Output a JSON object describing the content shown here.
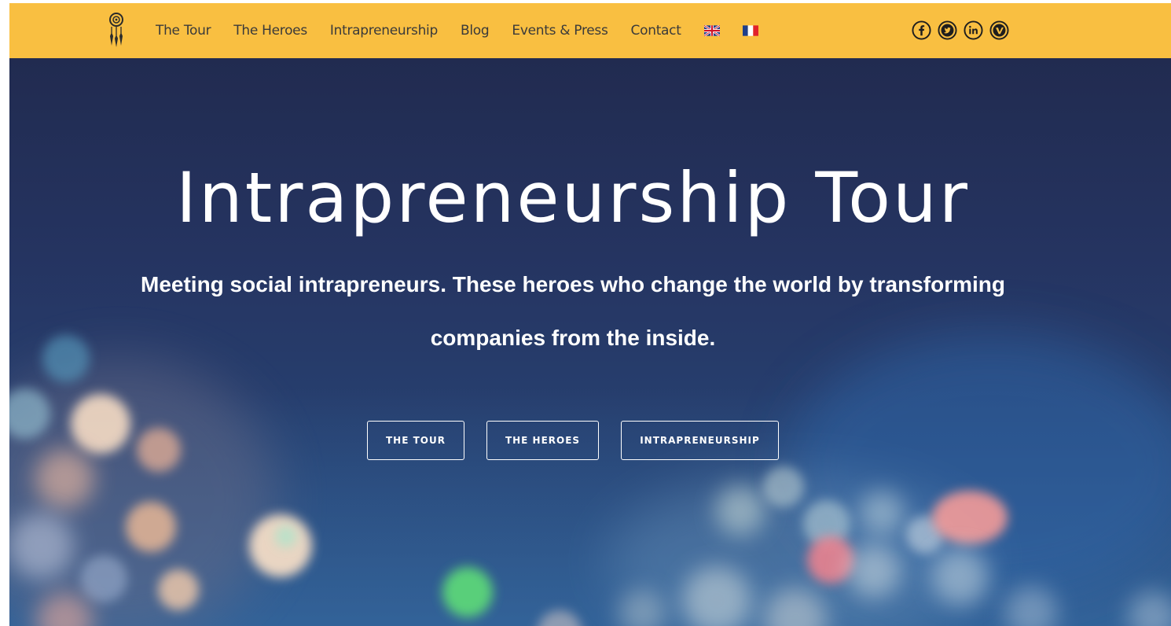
{
  "nav": {
    "logo_icon": "dreamcatcher-icon",
    "links": [
      "The Tour",
      "The Heroes",
      "Intrapreneurship",
      "Blog",
      "Events & Press",
      "Contact"
    ],
    "languages": [
      {
        "icon": "uk-flag-icon",
        "code": "EN"
      },
      {
        "icon": "france-flag-icon",
        "code": "FR"
      }
    ],
    "social": [
      "facebook-icon",
      "twitter-icon",
      "linkedin-icon",
      "vimeo-icon"
    ],
    "background_color": "#F9BF41",
    "text_color": "#3a3a3a"
  },
  "hero": {
    "title": "Intrapreneurship Tour",
    "subtitle": "Meeting social intrapreneurs. These heroes who change the world by transforming companies from the inside.",
    "buttons": [
      "THE TOUR",
      "THE HEROES",
      "INTRAPRENEURSHIP"
    ],
    "background_color": "#253461",
    "text_color": "#ffffff"
  }
}
